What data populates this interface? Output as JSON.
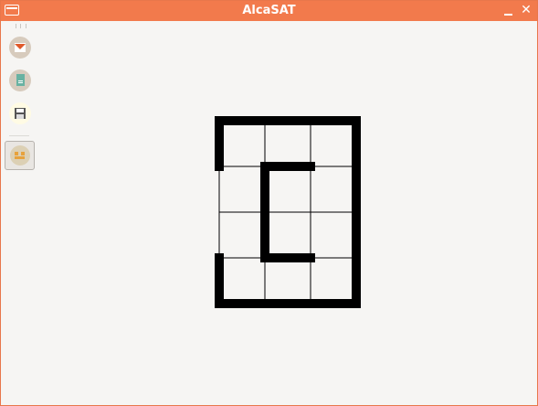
{
  "window": {
    "title": "AlcaSAT"
  },
  "toolbar": {
    "tools": [
      {
        "name": "open-icon"
      },
      {
        "name": "document-icon"
      },
      {
        "name": "save-icon"
      },
      {
        "name": "solve-toggle-icon",
        "active": true
      }
    ]
  },
  "puzzle": {
    "rows": 4,
    "cols": 3,
    "lines": [
      {
        "name": "top-edge"
      },
      {
        "name": "right-edge"
      },
      {
        "name": "bottom-edge"
      },
      {
        "name": "left-upper-edge"
      },
      {
        "name": "left-lower-edge"
      },
      {
        "name": "inner-top-segment"
      },
      {
        "name": "inner-left-segment"
      },
      {
        "name": "inner-bottom-segment"
      }
    ]
  },
  "colors": {
    "titlebar": "#f27a4c",
    "background": "#f6f5f3",
    "line": "#000000",
    "grid": "#000000"
  }
}
